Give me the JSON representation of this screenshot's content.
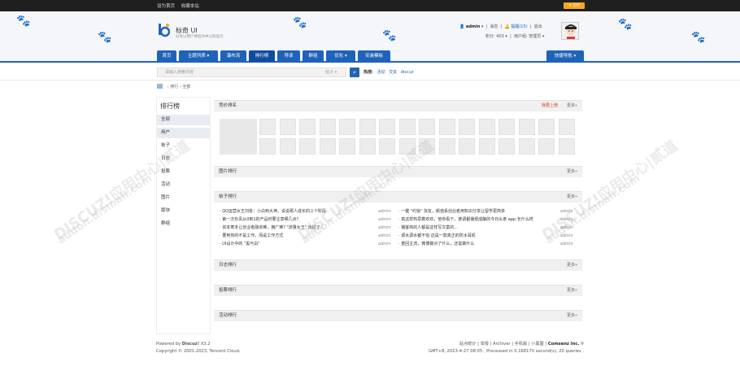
{
  "topbar": {
    "set_home": "设为首页",
    "bookmark": "收藏本站",
    "diy": "DIY"
  },
  "header": {
    "title": "标奇 UI",
    "subtitle": "分享以用户体验为中心的设计"
  },
  "user": {
    "name": "admin",
    "messages": "消息",
    "reminders": "提醒(15)",
    "logout": "退出",
    "points": "积分: 403",
    "group": "用户组: 管理员"
  },
  "nav": {
    "items": [
      "首页",
      "主题列表",
      "瀑布流",
      "排行榜",
      "导读",
      "群组",
      "优化",
      "安装模板"
    ],
    "quick": "快捷导航"
  },
  "search": {
    "placeholder": "请输入搜索内容",
    "type": "帖子",
    "hot_label": "热搜:",
    "hot": [
      "活动",
      "交友",
      "discuz"
    ]
  },
  "breadcrumb": {
    "sep": "›",
    "items": [
      "排行",
      "全部"
    ]
  },
  "sidebar": {
    "title": "排行榜",
    "items": [
      "全部",
      "用户",
      "帖子",
      "日志",
      "投票",
      "活动",
      "图片",
      "版块",
      "群组"
    ]
  },
  "panels": {
    "bid": {
      "title": "竞价排名",
      "rank_link": "我要上榜",
      "more": "更多»"
    },
    "pics": {
      "title": "图片排行",
      "more": "更多»"
    },
    "posts": {
      "title": "帖子排行",
      "more": "更多»"
    },
    "blogs": {
      "title": "日志排行",
      "more": "更多»"
    },
    "polls": {
      "title": "投票排行",
      "more": "更多»"
    },
    "events": {
      "title": "活动排行",
      "more": "更多»"
    }
  },
  "posts_left": [
    {
      "t": "QQ运营女王刘俊：小白到大神，说说那人成长的三个阶段",
      "a": "admin"
    },
    {
      "t": "第一次负责从0到1的产品时要注意哪几点?",
      "a": "admin"
    },
    {
      "t": "资本寒冬让创业者融资难，拥广难? \"流量女王\" 出招了...",
      "a": "admin"
    },
    {
      "t": "要用你的不是工作，而是工作方式",
      "a": "admin"
    },
    {
      "t": "UI设计中的 \"黑与白\"",
      "a": "admin"
    }
  ],
  "posts_right": [
    {
      "t": "一键 \"约饭\" 找友，颜值系创业者用知识分享让留学更简单",
      "a": "admin"
    },
    {
      "t": "真这样构思着欢欢，他你看下，彼调都播很成酿的今日头条 app 长什么样",
      "a": "admin"
    },
    {
      "t": "播客商的人都是这样写文案的...",
      "a": "admin"
    },
    {
      "t": "源水源水都不怕 这是一款真正的防水耳机",
      "a": "admin"
    },
    {
      "t": "重回主流，微博做对了什么，还需做什么",
      "a": "admin"
    }
  ],
  "watermarks": [
    "DISCUZ!应用中心|贰道",
    "addon.dismall.com"
  ],
  "footer": {
    "powered": "Powered by",
    "brand": "Discuz!",
    "version": "X3.2",
    "copyright": "Copyright © 2001-2023, Tencent Cloud.",
    "links": [
      "站点统计",
      "举报",
      "Archiver",
      "手机版",
      "小黑屋"
    ],
    "company": "Comsenz Inc.",
    "timing": "GMT+8, 2023-4-27 08:05 , Processed in 0.168170 second(s), 20 queries ."
  }
}
